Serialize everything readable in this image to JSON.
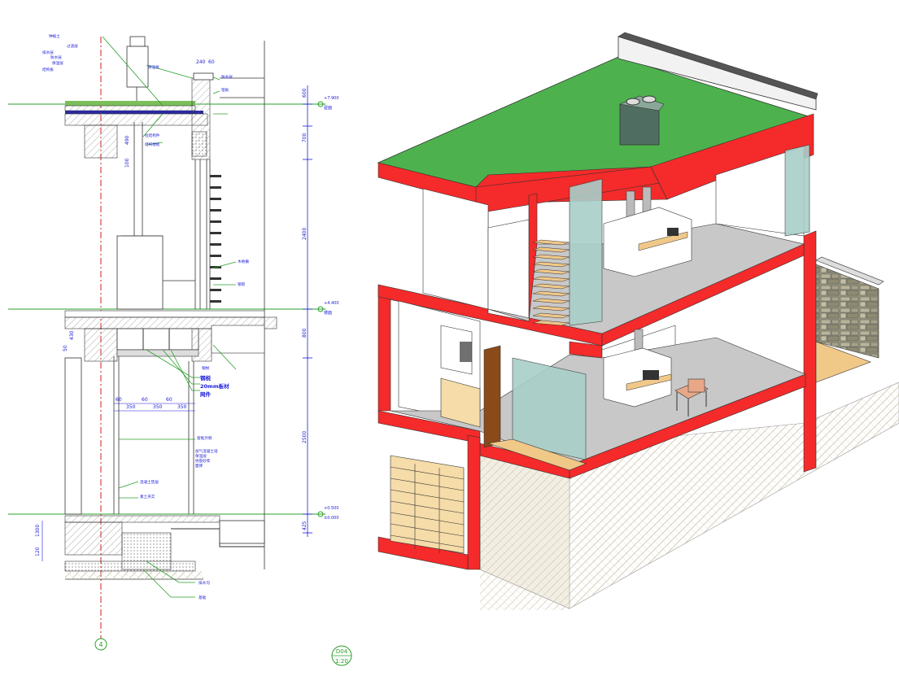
{
  "section": {
    "levels": [
      "+7.900",
      "+4.400",
      "+0.500",
      "±0.000"
    ],
    "level_notes": [
      "屋面",
      "楼面"
    ],
    "heights": [
      "600",
      "700",
      "2400",
      "800",
      "2500",
      "425"
    ],
    "small_dims": [
      "240",
      "60",
      "490",
      "100",
      "430",
      "50",
      "1300",
      "120"
    ],
    "spacing_dims": [
      "60",
      "350",
      "60",
      "350",
      "60",
      "350"
    ],
    "top_dims": [
      "60",
      "350",
      "60",
      "350",
      "60",
      "350"
    ],
    "grid_marker": "4",
    "notes": {
      "roof": [
        "种植土",
        "过滤层",
        "排水层",
        "防水层",
        "保温层",
        "结构板"
      ],
      "parapet": [
        "保温板",
        "防水层",
        "铝板"
      ],
      "middle": [
        "拉结构件",
        "结构楼板"
      ],
      "facade": [
        "木格栅",
        "钢管"
      ],
      "floor": [
        "钢棁",
        "20mm木板",
        "影墙"
      ],
      "bold_notes": [
        "钢棁",
        "20mm板材",
        "网件"
      ],
      "window": [
        "窗框外侧"
      ],
      "wall": [
        "加气混凝土墙",
        "保温层",
        "抗裂砂浆",
        "面砖"
      ],
      "base": [
        "混凝土垫层",
        "素土夹实"
      ],
      "ground": [
        "排水沟",
        "基础"
      ]
    }
  },
  "drawing_tag": {
    "code": "D04",
    "scale": "1:20"
  },
  "colors": {
    "dim_blue": "#1a1ad8",
    "grid_green": "#2aa02a",
    "axis_red": "#cc2222",
    "cut_red": "#f52a2a",
    "roof_green": "#4db24d",
    "slab_gray": "#c8c8c8",
    "soil": "#eeeae0",
    "wood": "#f0c888",
    "glass": "#a8cfc8"
  }
}
